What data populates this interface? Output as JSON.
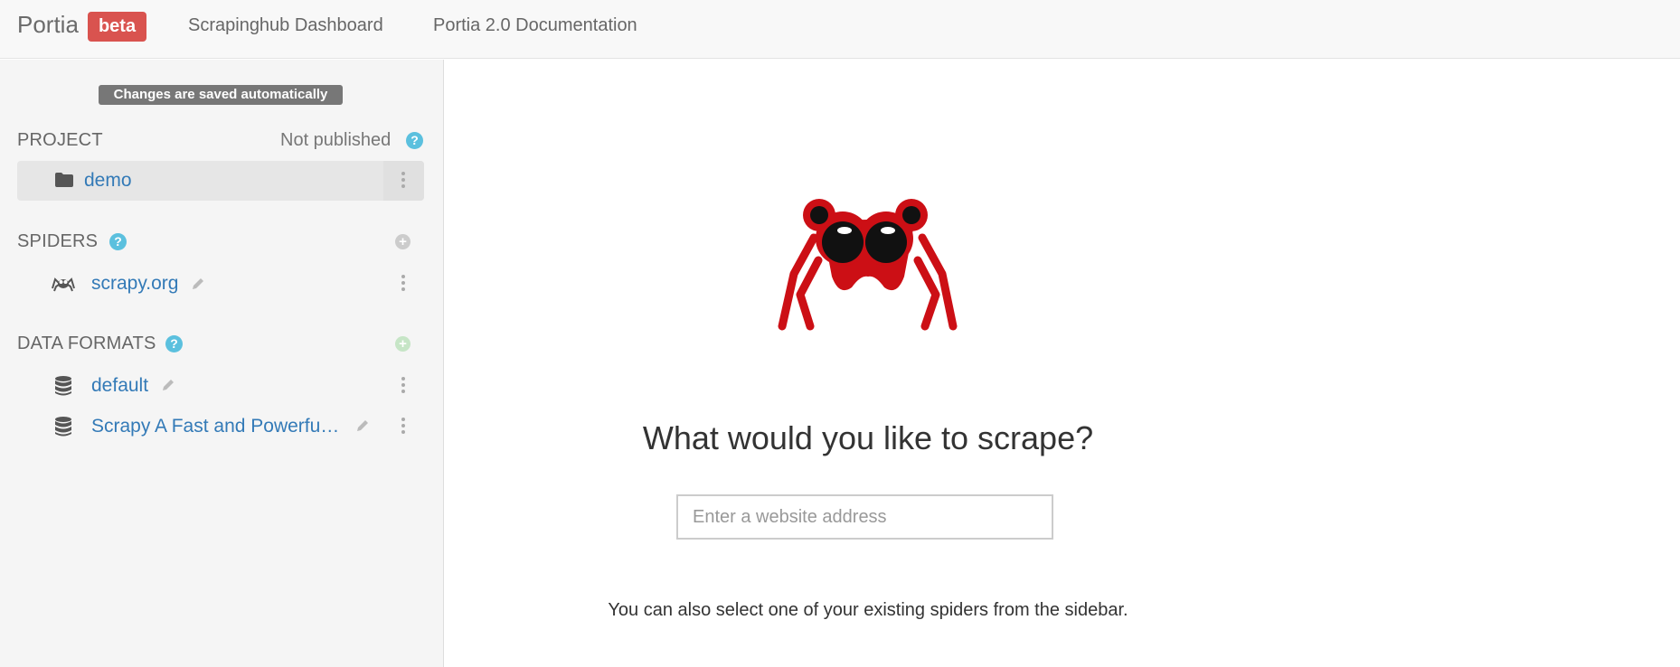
{
  "navbar": {
    "brand": "Portia",
    "beta": "beta",
    "links": [
      "Scrapinghub Dashboard",
      "Portia 2.0 Documentation"
    ]
  },
  "sidebar": {
    "saved_notice": "Changes are saved automatically",
    "project": {
      "label": "PROJECT",
      "status": "Not published",
      "name": "demo"
    },
    "spiders": {
      "label": "SPIDERS",
      "items": [
        {
          "label": "scrapy.org",
          "icon": "spider-icon"
        }
      ]
    },
    "data_formats": {
      "label": "DATA FORMATS",
      "items": [
        {
          "label": "default",
          "icon": "database-icon"
        },
        {
          "label": "Scrapy A Fast and Powerfu…",
          "icon": "database-icon"
        }
      ]
    }
  },
  "main": {
    "title": "What would you like to scrape?",
    "url_placeholder": "Enter a website address",
    "hint": "You can also select one of your existing spiders from the sidebar."
  },
  "colors": {
    "accent": "#337ab7",
    "beta_badge": "#d9534f",
    "help": "#5bc0de",
    "logo_red": "#cc0f15"
  }
}
